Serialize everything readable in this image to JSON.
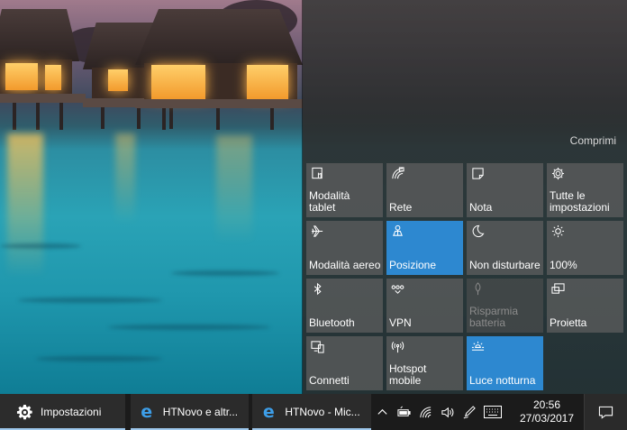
{
  "action_center": {
    "collapse_label": "Comprimi",
    "tiles": [
      {
        "label": "Modalità\ntablet",
        "icon": "tablet-mode-icon",
        "state": "normal"
      },
      {
        "label": "Rete",
        "icon": "network-icon",
        "state": "normal"
      },
      {
        "label": "Nota",
        "icon": "note-icon",
        "state": "normal"
      },
      {
        "label": "Tutte le\nimpostazioni",
        "icon": "gear-icon",
        "state": "normal"
      },
      {
        "label": "Modalità aereo",
        "icon": "airplane-icon",
        "state": "normal"
      },
      {
        "label": "Posizione",
        "icon": "location-icon",
        "state": "active"
      },
      {
        "label": "Non disturbare",
        "icon": "moon-icon",
        "state": "normal"
      },
      {
        "label": "100%",
        "icon": "brightness-icon",
        "state": "normal"
      },
      {
        "label": "Bluetooth",
        "icon": "bluetooth-icon",
        "state": "normal"
      },
      {
        "label": "VPN",
        "icon": "vpn-icon",
        "state": "normal"
      },
      {
        "label": "Risparmia\nbatteria",
        "icon": "battery-saver-icon",
        "state": "disabled"
      },
      {
        "label": "Proietta",
        "icon": "project-icon",
        "state": "normal"
      },
      {
        "label": "Connetti",
        "icon": "connect-icon",
        "state": "normal"
      },
      {
        "label": "Hotspot\nmobile",
        "icon": "hotspot-icon",
        "state": "normal"
      },
      {
        "label": "Luce notturna",
        "icon": "night-light-icon",
        "state": "active"
      }
    ]
  },
  "taskbar": {
    "apps": [
      {
        "label": "Impostazioni",
        "icon": "gear-icon"
      },
      {
        "label": "HTNovo e altr...",
        "icon": "edge-icon"
      },
      {
        "label": "HTNovo - Mic...",
        "icon": "edge-icon"
      }
    ],
    "tray_icons": [
      "chevron-up-icon",
      "battery-icon",
      "wifi-icon",
      "volume-icon",
      "pen-icon",
      "keyboard-icon"
    ],
    "time": "20:56",
    "date": "27/03/2017",
    "notification_icon": "notification-icon"
  },
  "colors": {
    "accent": "#2d88d0",
    "taskbar": "#1b1b1b",
    "tile": "#5f5f5f"
  }
}
